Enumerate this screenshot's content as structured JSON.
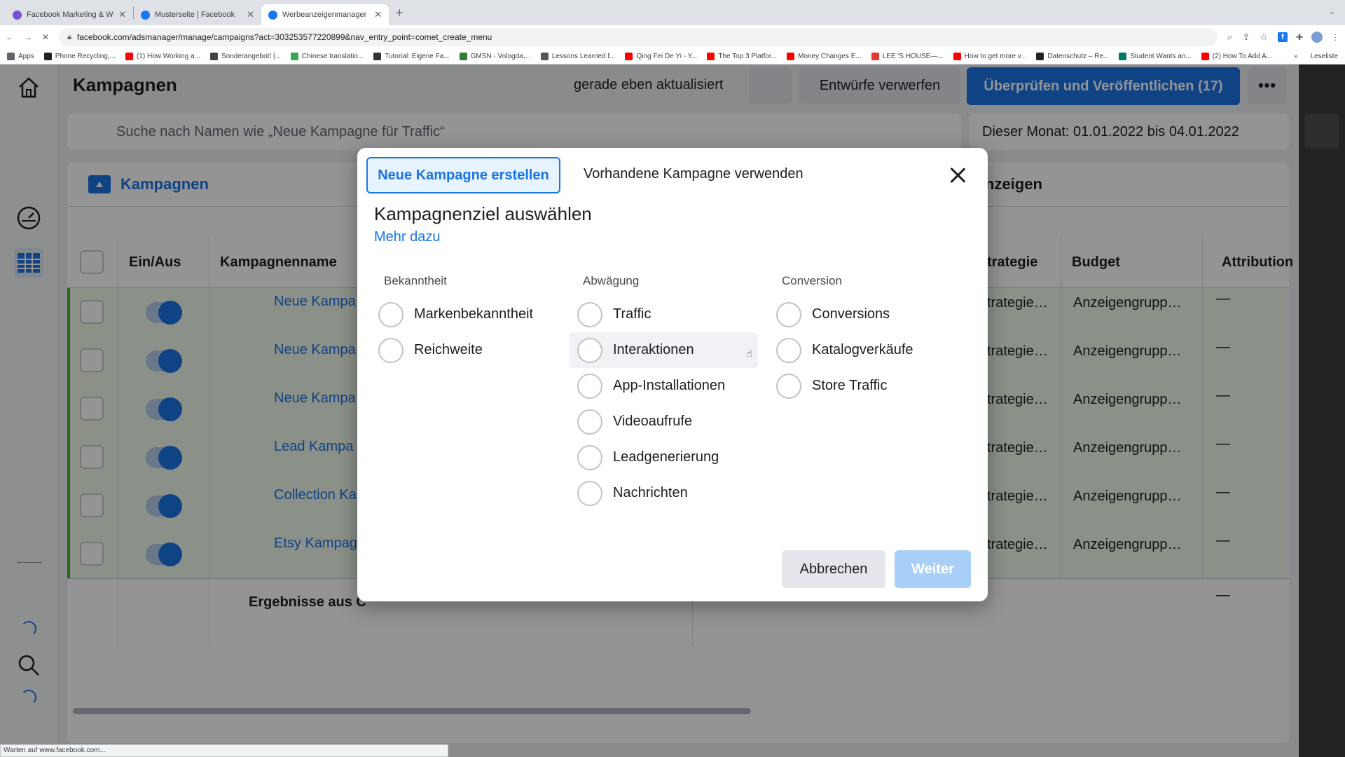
{
  "browser": {
    "tabs": [
      {
        "title": "Facebook Marketing & Werbe…",
        "color": "#7b4fd1",
        "active": false
      },
      {
        "title": "Musterseite | Facebook",
        "color": "#1877f2",
        "active": false
      },
      {
        "title": "Werbeanzeigenmanager - Wer…",
        "color": "#1877f2",
        "active": true
      }
    ],
    "url": "facebook.com/adsmanager/manage/campaigns?act=303253577220899&nav_entry_point=comet_create_menu",
    "bookmarks": [
      {
        "label": "Apps",
        "color": "#5f6368"
      },
      {
        "label": "Phone Recycling,...",
        "color": "#202124"
      },
      {
        "label": "(1) How Working a...",
        "color": "#ff0000"
      },
      {
        "label": "Sonderangebot! |...",
        "color": "#444444"
      },
      {
        "label": "Chinese translatio...",
        "color": "#34a853"
      },
      {
        "label": "Tutorial: Eigene Fa...",
        "color": "#333333"
      },
      {
        "label": "GMSN - Vologda,...",
        "color": "#2e7d32"
      },
      {
        "label": "Lessons Learned f...",
        "color": "#555555"
      },
      {
        "label": "Qing Fei De Yi - Y...",
        "color": "#ff0000"
      },
      {
        "label": "The Top 3 Platfor...",
        "color": "#ff0000"
      },
      {
        "label": "Money Changes E...",
        "color": "#ff0000"
      },
      {
        "label": "LEE 'S HOUSE—...",
        "color": "#e53935"
      },
      {
        "label": "How to get more v...",
        "color": "#ff0000"
      },
      {
        "label": "Datenschutz – Re...",
        "color": "#222222"
      },
      {
        "label": "Student Wants an...",
        "color": "#00796b"
      },
      {
        "label": "(2) How To Add A...",
        "color": "#ff0000"
      }
    ],
    "bookmarks_more": "»",
    "reading_list": "Leseliste",
    "status": "Warten auf www.facebook.com..."
  },
  "topbar": {
    "title": "Kampagnen",
    "updated": "gerade eben aktualisiert",
    "discard": "Entwürfe verwerfen",
    "publish": "Überprüfen und Veröffentlichen (17)",
    "more": "•••"
  },
  "search": {
    "placeholder": "Suche nach Namen wie „Neue Kampagne für Traffic“",
    "date_range": "Dieser Monat: 01.01.2022 bis 04.01.2022"
  },
  "panel": {
    "tab_campaigns": "Kampagnen",
    "tab_ads_partial": "nzeigen"
  },
  "table": {
    "headers": {
      "onoff": "Ein/Aus",
      "name": "Kampagnenname",
      "strategy": "trategie",
      "budget": "Budget",
      "attribution": "Attribution"
    },
    "rows": [
      {
        "name": "Neue Kampa",
        "strategy": "trategie…",
        "budget": "Anzeigengrupp…",
        "attribution": "—"
      },
      {
        "name": "Neue Kampa",
        "strategy": "trategie…",
        "budget": "Anzeigengrupp…",
        "attribution": "—"
      },
      {
        "name": "Neue Kampa",
        "strategy": "trategie…",
        "budget": "Anzeigengrupp…",
        "attribution": "—"
      },
      {
        "name": "Lead Kampa",
        "strategy": "trategie…",
        "budget": "Anzeigengrupp…",
        "attribution": "—"
      },
      {
        "name": "Collection Ka",
        "strategy": "trategie…",
        "budget": "Anzeigengrupp…",
        "attribution": "—"
      },
      {
        "name": "Etsy Kampag",
        "strategy": "trategie…",
        "budget": "Anzeigengrupp…",
        "attribution": "—"
      }
    ],
    "results_label": "Ergebnisse aus C",
    "results_attribution": "—"
  },
  "modal": {
    "tab_new": "Neue Kampagne erstellen",
    "tab_existing": "Vorhandene Kampagne verwenden",
    "title": "Kampagnenziel auswählen",
    "learn_more": "Mehr dazu",
    "columns": [
      {
        "heading": "Bekanntheit",
        "options": [
          "Markenbekanntheit",
          "Reichweite"
        ]
      },
      {
        "heading": "Abwägung",
        "options": [
          "Traffic",
          "Interaktionen",
          "App-Installationen",
          "Videoaufrufe",
          "Leadgenerierung",
          "Nachrichten"
        ]
      },
      {
        "heading": "Conversion",
        "options": [
          "Conversions",
          "Katalogverkäufe",
          "Store Traffic"
        ]
      }
    ],
    "cancel": "Abbrechen",
    "next": "Weiter"
  },
  "colors": {
    "accent": "#1b74e4",
    "row_background": "#f0f8ec",
    "active_row_marker": "#42b72a"
  }
}
